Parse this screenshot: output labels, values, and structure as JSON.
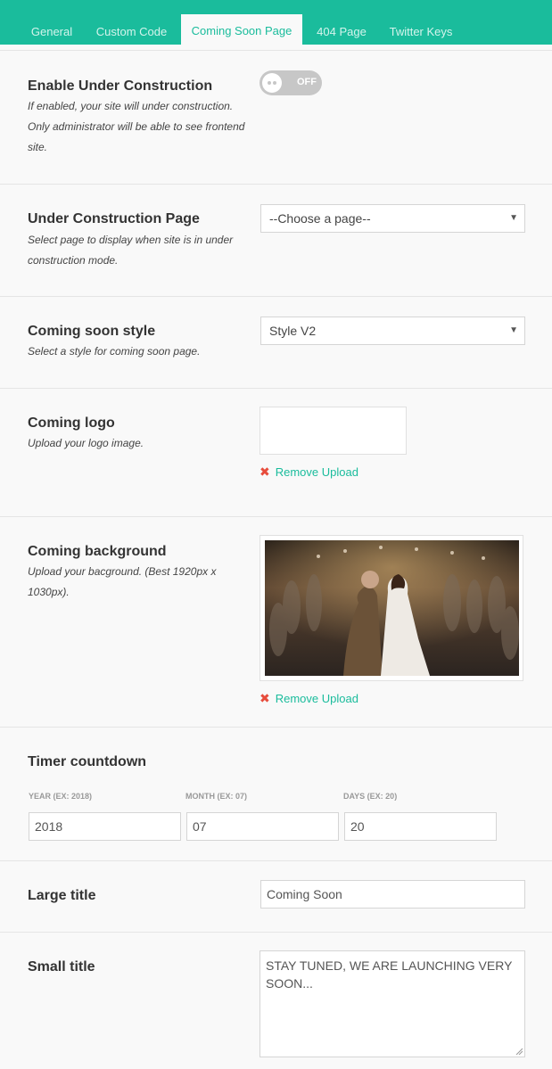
{
  "tabs": [
    {
      "label": "General"
    },
    {
      "label": "Custom Code"
    },
    {
      "label": "Coming Soon Page"
    },
    {
      "label": "404 Page"
    },
    {
      "label": "Twitter Keys"
    }
  ],
  "enable": {
    "label": "Enable Under Construction",
    "desc": "If enabled, your site will under construction. Only administrator will be able to see frontend site.",
    "toggle_text": "OFF"
  },
  "page": {
    "label": "Under Construction Page",
    "desc": "Select page to display when site is in under construction mode.",
    "selected": "--Choose a page--"
  },
  "style": {
    "label": "Coming soon style",
    "desc": "Select a style for coming soon page.",
    "selected": "Style V2"
  },
  "logo": {
    "label": "Coming logo",
    "desc": "Upload your logo image.",
    "remove": "Remove Upload"
  },
  "background": {
    "label": "Coming background",
    "desc": "Upload your bacground. (Best 1920px x 1030px).",
    "remove": "Remove Upload"
  },
  "timer": {
    "label": "Timer countdown",
    "year_label": "YEAR (EX: 2018)",
    "month_label": "MONTH (EX: 07)",
    "days_label": "DAYS (EX: 20)",
    "year": "2018",
    "month": "07",
    "days": "20"
  },
  "large_title": {
    "label": "Large title",
    "value": "Coming Soon"
  },
  "small_title": {
    "label": "Small title",
    "value": "STAY TUNED, WE ARE LAUNCHING VERY SOON..."
  },
  "icons": {
    "select_arrow": "▼",
    "remove": "✖"
  },
  "colors": {
    "accent": "#1abc9c",
    "remove_icon": "#e74c3c"
  }
}
